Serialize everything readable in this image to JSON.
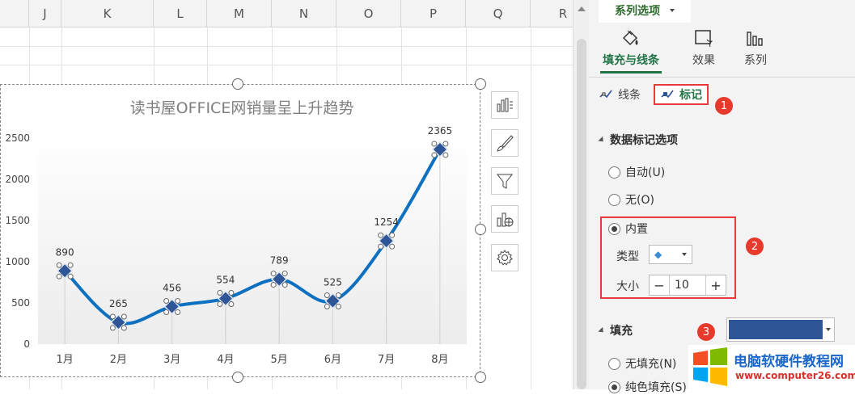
{
  "sheet": {
    "columns": [
      "J",
      "K",
      "L",
      "M",
      "N",
      "O",
      "P",
      "Q",
      "R"
    ]
  },
  "chart_data": {
    "type": "line",
    "title": "读书屋OFFICE网销量呈上升趋势",
    "categories": [
      "1月",
      "2月",
      "3月",
      "4月",
      "5月",
      "6月",
      "7月",
      "8月"
    ],
    "values": [
      890,
      265,
      456,
      554,
      789,
      525,
      1254,
      2365
    ],
    "yticks": [
      0,
      500,
      1000,
      1500,
      2000,
      2500
    ],
    "ylim": [
      0,
      2600
    ],
    "smooth": true,
    "line_color": "#0e70c0",
    "marker": "diamond",
    "marker_color": "#2e5596",
    "data_labels": true,
    "grid": false,
    "xlabel": "",
    "ylabel": ""
  },
  "chart_tools": {
    "icons": [
      "chart-elements-icon",
      "chart-styles-icon",
      "chart-filters-icon",
      "chart-insert-icon",
      "chart-settings-icon"
    ]
  },
  "pane": {
    "title": "系列选项",
    "tabs": [
      {
        "label": "填充与线条",
        "icon": "paint-bucket-icon",
        "active": true
      },
      {
        "label": "效果",
        "icon": "effects-icon",
        "active": false
      },
      {
        "label": "系列",
        "icon": "series-bars-icon",
        "active": false
      }
    ],
    "subtabs": {
      "line": "线条",
      "marker": "标记"
    },
    "marker_options": {
      "heading": "数据标记选项",
      "options": [
        "自动(U)",
        "无(O)",
        "内置"
      ],
      "selected": "内置",
      "type_label": "类型",
      "type_value": "◆",
      "size_label": "大小",
      "size_value": "10",
      "minus": "−",
      "plus": "+"
    },
    "fill": {
      "heading": "填充",
      "color": "#2e5596",
      "options": [
        "无填充(N)",
        "纯色填充(S)"
      ],
      "selected": "纯色填充(S)"
    },
    "badges": [
      "1",
      "2",
      "3"
    ]
  },
  "watermark": {
    "title": "电脑软硬件教程网",
    "url": "www.computer26.com"
  }
}
